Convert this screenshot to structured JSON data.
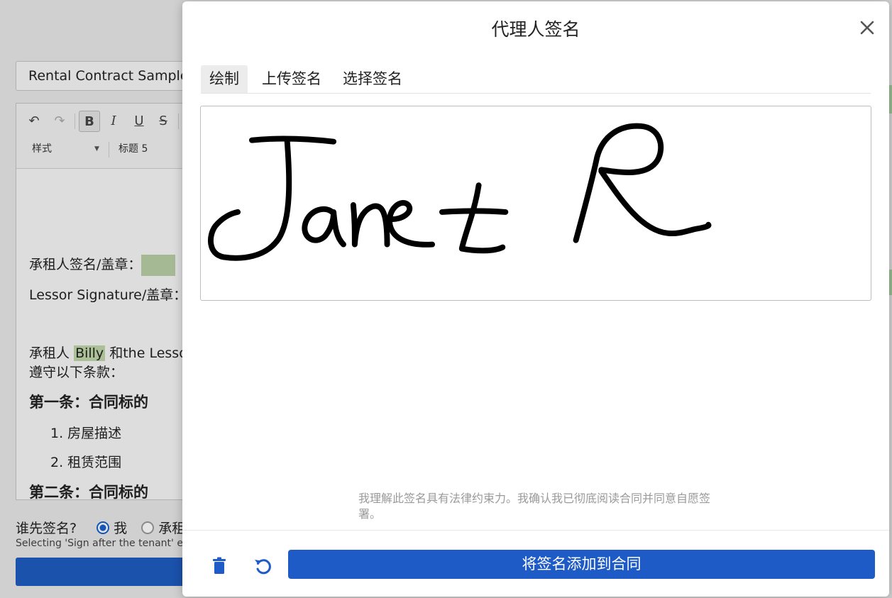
{
  "background": {
    "contract_title": "Rental Contract Sample",
    "toolbar": {
      "style_label": "样式",
      "heading_label": "标题 5",
      "bold": "B",
      "italic": "I",
      "underline": "U",
      "strike": "S"
    },
    "doc": {
      "tenant_sign_label": "承租人签名/盖章：",
      "lessor_sign_label": "Lessor Signature/盖章：",
      "intro_prefix": "承租人",
      "tenant_name": "Billy",
      "intro_suffix": "和the Lessor",
      "intro_line2": "遵守以下条款：",
      "article1": "第一条：合同标的",
      "item1": "1. 房屋描述",
      "item2": "2. 租赁范围",
      "article2": "第二条：合同标的"
    },
    "who_signs_first": {
      "question": "谁先签名?",
      "option_me": "我",
      "option_tenant": "承租"
    },
    "note": "Selecting 'Sign after the tenant' en"
  },
  "modal": {
    "title": "代理人签名",
    "tabs": [
      {
        "label": "绘制",
        "active": true
      },
      {
        "label": "上传签名",
        "active": false
      },
      {
        "label": "选择签名",
        "active": false
      }
    ],
    "signature_text": "Janet R",
    "legal_text": "我理解此签名具有法律约束力。我确认我已彻底阅读合同并同意自愿签署。",
    "primary_button": "将签名添加到合同",
    "icons": {
      "close": "close-icon",
      "delete": "trash-icon",
      "reset": "undo-icon"
    },
    "colors": {
      "primary": "#1e5bc6",
      "ink": "#000000"
    }
  }
}
